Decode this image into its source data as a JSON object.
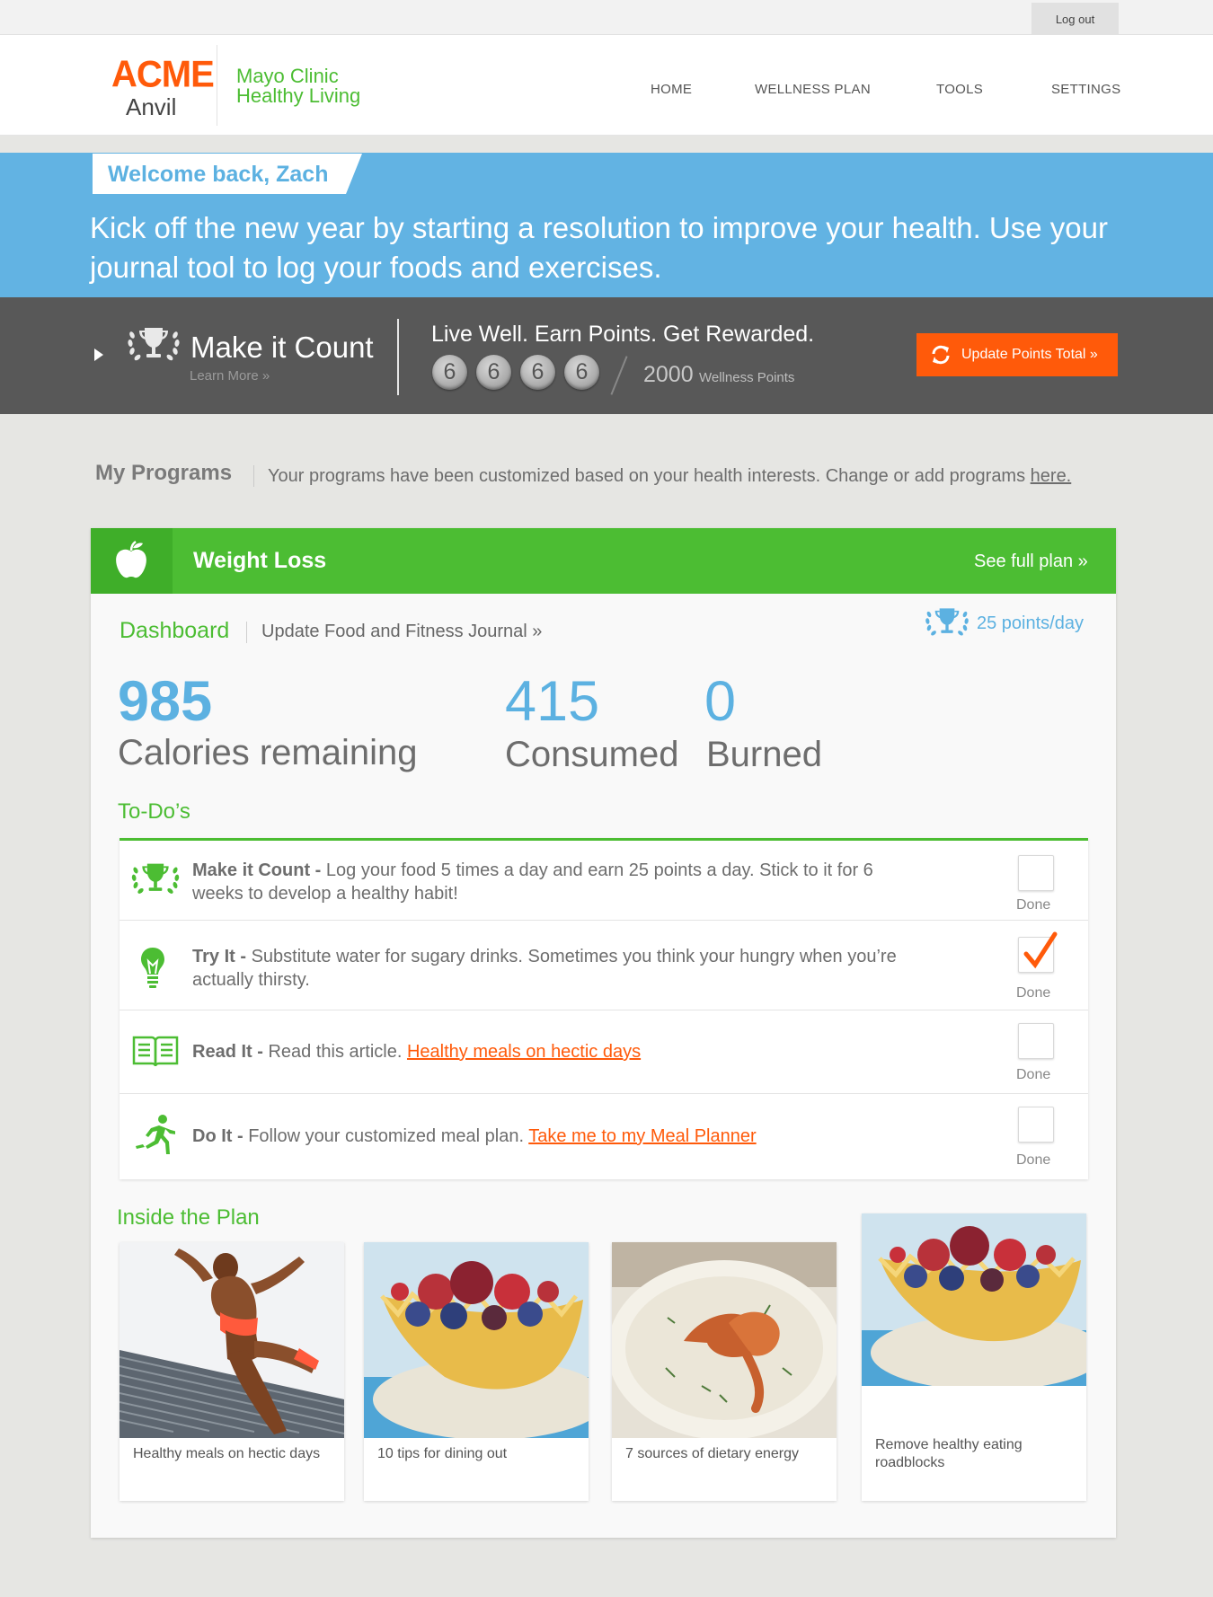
{
  "topbar": {
    "logout_label": "Log out"
  },
  "header": {
    "logo_main": "ACME",
    "logo_sub": "Anvil",
    "brand_line1": "Mayo Clinic",
    "brand_line2": "Healthy Living",
    "nav": [
      "HOME",
      "WELLNESS PLAN",
      "TOOLS",
      "SETTINGS"
    ]
  },
  "welcome": {
    "greeting": "Welcome back, Zach",
    "message": "Kick off the new year by starting a resolution to improve your health. Use your journal tool to log your foods and exercises."
  },
  "points_bar": {
    "title": "Make it Count",
    "learn_more": "Learn More »",
    "tagline": "Live Well. Earn Points. Get Rewarded.",
    "digits": [
      "6",
      "6",
      "6",
      "6"
    ],
    "total": "2000",
    "unit": "Wellness Points",
    "update_button": "Update Points Total »"
  },
  "programs": {
    "title": "My Programs",
    "description": "Your programs have been customized based on your health interests. Change or add programs ",
    "link": "here."
  },
  "card": {
    "title": "Weight Loss",
    "full_plan": "See full plan »",
    "dashboard_label": "Dashboard",
    "journal_link": "Update Food and Fitness Journal »",
    "points_per_day": "25 points/day",
    "stats": {
      "remaining_value": "985",
      "remaining_label": "Calories remaining",
      "consumed_value": "415",
      "consumed_label": "Consumed",
      "burned_value": "0",
      "burned_label": "Burned"
    },
    "todo_title": "To-Do’s",
    "todos": [
      {
        "title": "Make it Count -",
        "text": " Log your food 5 times a day and earn 25 points a day. Stick to it for 6 weeks to develop a healthy habit!",
        "link": "",
        "done_label": "Done",
        "checked": false
      },
      {
        "title": "Try It -",
        "text": " Substitute water for sugary drinks. Sometimes you think your hungry when you’re actually thirsty.",
        "link": "",
        "done_label": "Done",
        "checked": true
      },
      {
        "title": "Read It -",
        "text": " Read this article. ",
        "link": "Healthy meals on hectic days",
        "done_label": "Done",
        "checked": false
      },
      {
        "title": "Do It -",
        "text": " Follow your customized meal plan. ",
        "link": "Take me to my Meal Planner",
        "done_label": "Done",
        "checked": false
      }
    ],
    "inside_title": "Inside the Plan",
    "tiles": [
      {
        "caption": "Healthy meals on hectic days"
      },
      {
        "caption": "10 tips for dining out"
      },
      {
        "caption": "7 sources of dietary energy"
      },
      {
        "caption": "Remove healthy eating roadblocks"
      }
    ]
  },
  "colors": {
    "brand_orange": "#ff5a0a",
    "brand_green": "#4cbd33",
    "banner_blue": "#62b3e3",
    "points_bar_gray": "#585858",
    "stat_blue": "#5cb1e1"
  }
}
